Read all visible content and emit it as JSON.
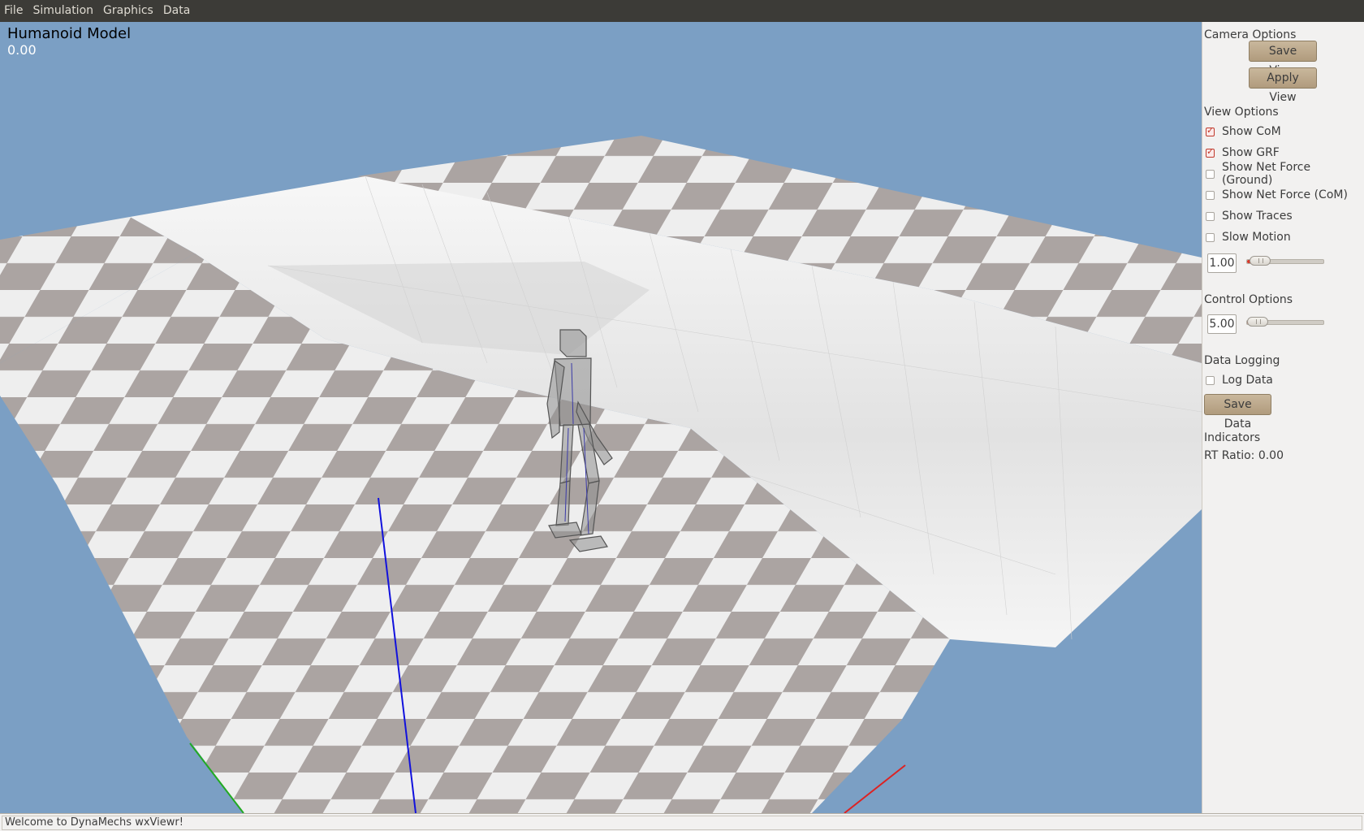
{
  "menubar": {
    "items": [
      "File",
      "Simulation",
      "Graphics",
      "Data"
    ]
  },
  "viewport": {
    "model_title": "Humanoid Model",
    "sim_time": "0.00"
  },
  "panel": {
    "camera_title": "Camera Options",
    "save_view": "Save View",
    "apply_view": "Apply View",
    "view_title": "View Options",
    "view_checks": [
      {
        "label": "Show CoM",
        "checked": true
      },
      {
        "label": "Show GRF",
        "checked": true
      },
      {
        "label": "Show Net Force (Ground)",
        "checked": false
      },
      {
        "label": "Show Net Force (CoM)",
        "checked": false
      },
      {
        "label": "Show Traces",
        "checked": false
      },
      {
        "label": "Slow Motion",
        "checked": false
      }
    ],
    "slow_motion_value": "1.00",
    "slow_motion_level": 0.05,
    "control_title": "Control Options",
    "control_value": "5.00",
    "control_level": 0.0,
    "logging_title": "Data Logging",
    "log_data": {
      "label": "Log Data",
      "checked": false
    },
    "save_data": "Save Data",
    "indicators_title": "Indicators",
    "rt_ratio": "RT Ratio: 0.00"
  },
  "statusbar": {
    "text": "Welcome to DynaMechs wxViewr!"
  },
  "colors": {
    "sky": "#7b9fc4",
    "checker_dark": "#aba4a2",
    "checker_light": "#eeeeee",
    "grf_line": "#1111dd"
  }
}
